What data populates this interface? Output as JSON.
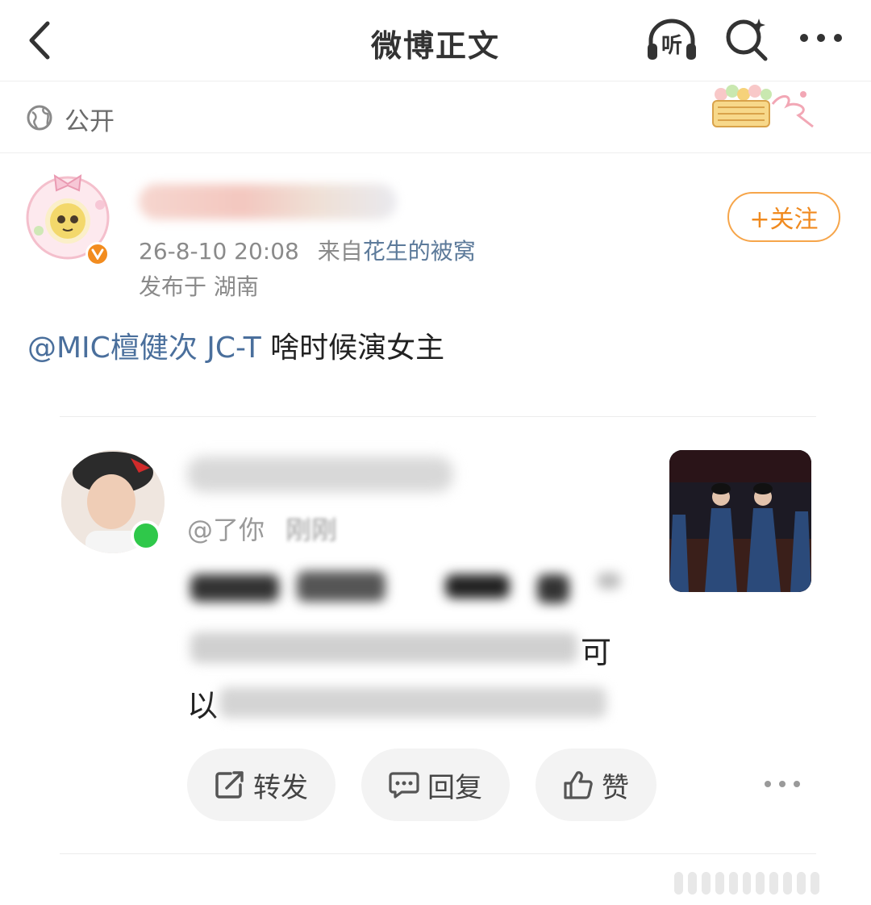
{
  "nav": {
    "title": "微博正文",
    "listen_label": "听"
  },
  "visibility": {
    "label": "公开"
  },
  "post": {
    "timestamp": "26-8-10 20:08",
    "source_prefix": "来自",
    "source_name": "花生的被窝",
    "location": "发布于 湖南",
    "follow_label": "+关注",
    "mention": "@MIC檀健次 JC-T",
    "text": " 啥时候演女主"
  },
  "quoted": {
    "handle_prefix": "@了你",
    "time": "刚刚",
    "line3_tail": "可",
    "line4_head": "以"
  },
  "actions": {
    "repost_label": "转发",
    "reply_label": "回复",
    "like_label": "赞"
  },
  "colors": {
    "accent_orange": "#f08a1f",
    "link_blue": "#4a6f9c",
    "online_green": "#2fc84a"
  }
}
